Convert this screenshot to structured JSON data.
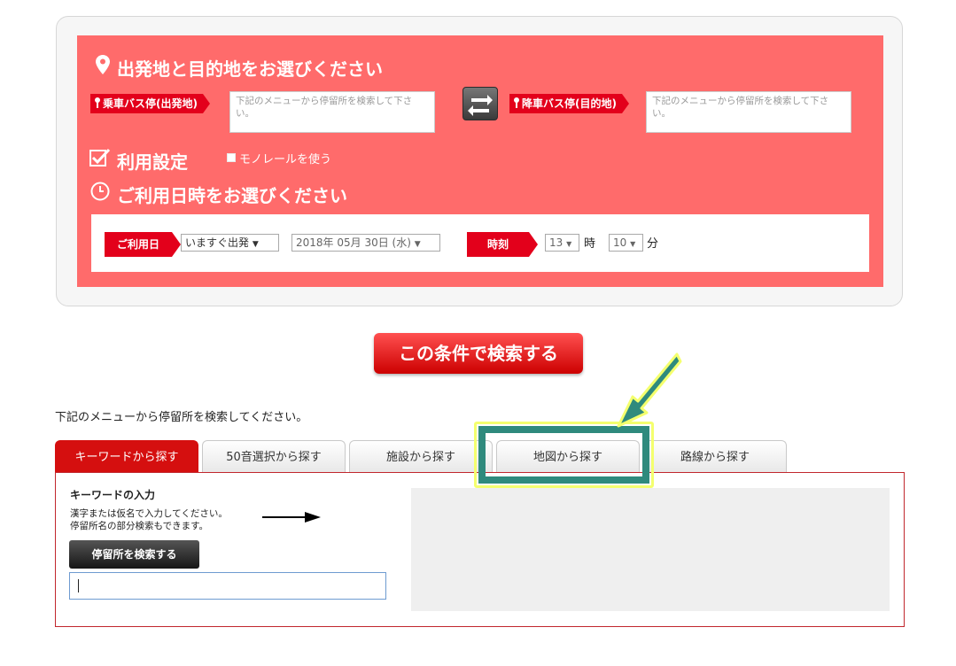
{
  "route": {
    "heading": "出発地と目的地をお選びください",
    "boarding_label": "乗車バス停(出発地)",
    "boarding_value": "下記のメニューから停留所を検索して下さい。",
    "alighting_label": "降車バス停(目的地)",
    "alighting_value": "下記のメニューから停留所を検索して下さい。"
  },
  "usage": {
    "heading": "利用設定",
    "monorail_label": "モノレールを使う"
  },
  "datetime": {
    "heading": "ご利用日時をお選びください",
    "date_label": "ご利用日",
    "departure_select": "いますぐ出発",
    "date_select": "2018年 05月 30日 (水)",
    "time_label": "時刻",
    "hour_select": "13",
    "hour_unit": "時",
    "minute_select": "10",
    "minute_unit": "分"
  },
  "search_button": "この条件で検索する",
  "hint": "下記のメニューから停留所を検索してください。",
  "tabs": [
    {
      "label": "キーワードから探す"
    },
    {
      "label": "50音選択から探す"
    },
    {
      "label": "施設から探す"
    },
    {
      "label": "地図から探す"
    },
    {
      "label": "路線から探す"
    }
  ],
  "keyword": {
    "title": "キーワードの入力",
    "desc1": "漢字または仮名で入力してください。",
    "desc2": "停留所名の部分検索もできます。",
    "button": "停留所を検索する",
    "input_value": ""
  },
  "colors": {
    "panel": "#ff6b6b",
    "accent": "#e3001b",
    "highlight_fill": "#2f8a7d",
    "highlight_border": "#f4ff6e"
  }
}
